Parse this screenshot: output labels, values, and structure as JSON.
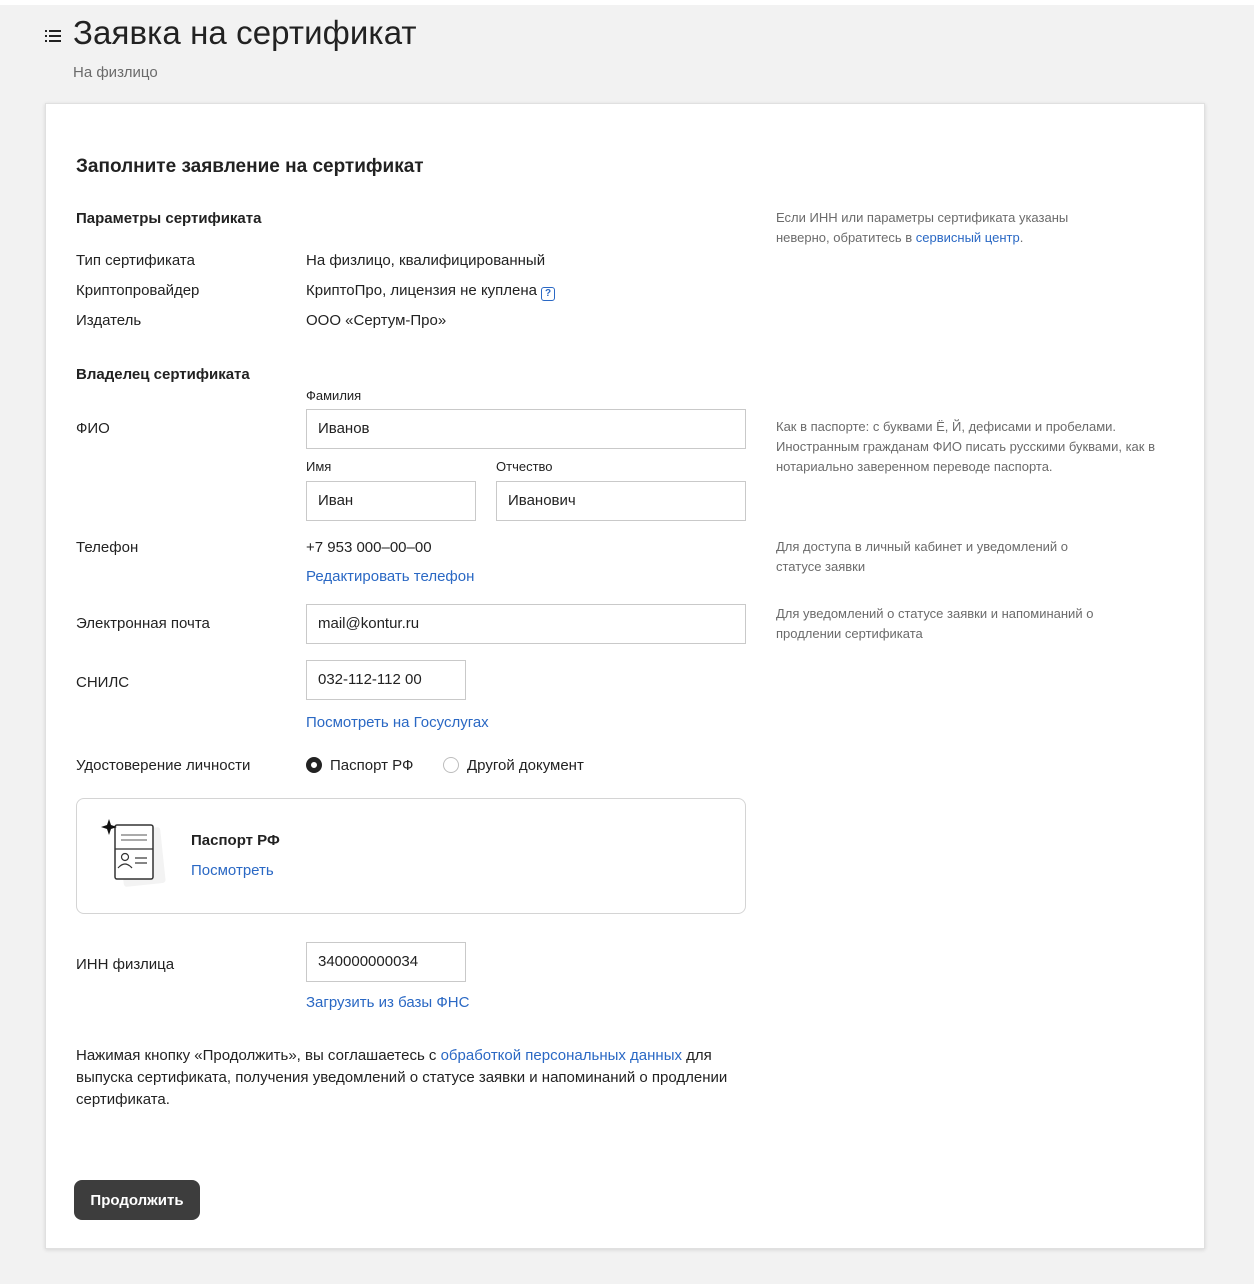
{
  "header": {
    "title": "Заявка на сертификат",
    "subtitle": "На физлицо"
  },
  "form": {
    "title": "Заполните заявление на сертификат",
    "params": {
      "section_title": "Параметры сертификата",
      "hint_before": "Если ИНН или параметры сертификата указаны неверно, обратитесь в ",
      "hint_link": "сервисный центр",
      "hint_after": ".",
      "rows": [
        {
          "label": "Тип сертификата",
          "value": "На физлицо, квалифицированный"
        },
        {
          "label": "Криптопровайдер",
          "value": "КриптоПро, лицензия не куплена"
        },
        {
          "label": "Издатель",
          "value": "ООО «Сертум-Про»"
        }
      ],
      "help_icon_glyph": "?"
    },
    "owner": {
      "section_title": "Владелец сертификата",
      "fio_label": "ФИО",
      "surname_caption": "Фамилия",
      "surname_value": "Иванов",
      "name_caption": "Имя",
      "name_value": "Иван",
      "patronymic_caption": "Отчество",
      "patronymic_value": "Иванович",
      "fio_hint": "Как в паспорте: с буквами Ё, Й, дефисами и пробелами. Иностранным гражданам ФИО писать русскими буквами, как в нотариально заверенном переводе паспорта.",
      "phone_label": "Телефон",
      "phone_value": "+7 953 000–00–00",
      "phone_edit_link": "Редактировать телефон",
      "phone_hint": "Для доступа в личный кабинет и уведомлений о статусе заявки",
      "email_label": "Электронная почта",
      "email_value": "mail@kontur.ru",
      "email_hint": "Для уведомлений о статусе заявки и напоминаний о продлении сертификата",
      "snils_label": "СНИЛС",
      "snils_value": "032-112-112 00",
      "snils_link": "Посмотреть на Госуслугах",
      "id_label": "Удостоверение личности",
      "id_options": [
        {
          "label": "Паспорт РФ",
          "checked": true
        },
        {
          "label": "Другой документ",
          "checked": false
        }
      ],
      "passport_card_title": "Паспорт РФ",
      "passport_card_link": "Посмотреть",
      "inn_label": "ИНН физлица",
      "inn_value": "340000000034",
      "inn_link": "Загрузить из базы ФНС"
    },
    "consent": {
      "before": "Нажимая кнопку «Продолжить», вы соглашаетесь с ",
      "link": "обработкой персональных данных",
      "after": " для выпуска сертификата, получения уведомлений о статусе заявки и напоминаний о продлении сертификата."
    },
    "submit_label": "Продолжить"
  },
  "colors": {
    "link": "#2a68c4",
    "button_bg": "#3d3d3d",
    "page_bg": "#f2f2f2"
  }
}
